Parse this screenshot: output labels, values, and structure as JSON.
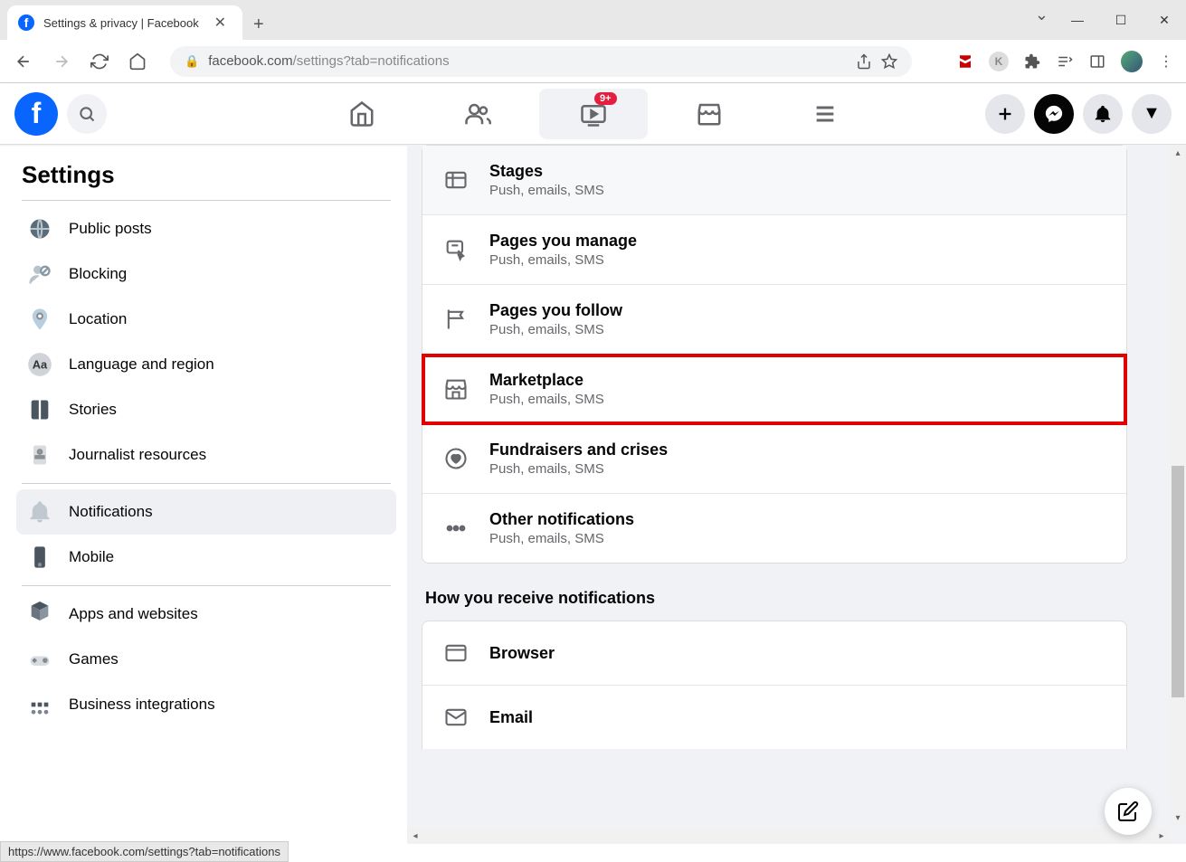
{
  "browser": {
    "tab_title": "Settings & privacy | Facebook",
    "url_host": "facebook.com",
    "url_path": "/settings?tab=notifications"
  },
  "fb_nav": {
    "watch_badge": "9+"
  },
  "sidebar": {
    "title": "Settings",
    "items_top": [
      {
        "label": "Public posts",
        "icon": "globe"
      },
      {
        "label": "Blocking",
        "icon": "user-block"
      },
      {
        "label": "Location",
        "icon": "pin"
      },
      {
        "label": "Language and region",
        "icon": "aa"
      },
      {
        "label": "Stories",
        "icon": "book"
      },
      {
        "label": "Journalist resources",
        "icon": "badge"
      }
    ],
    "items_mid": [
      {
        "label": "Notifications",
        "icon": "bell",
        "active": true
      },
      {
        "label": "Mobile",
        "icon": "mobile"
      }
    ],
    "items_bot": [
      {
        "label": "Apps and websites",
        "icon": "apps"
      },
      {
        "label": "Games",
        "icon": "games"
      },
      {
        "label": "Business integrations",
        "icon": "biz"
      }
    ]
  },
  "main": {
    "rows": [
      {
        "title": "Stages",
        "sub": "Push, emails, SMS",
        "icon": "grid",
        "hovered": true
      },
      {
        "title": "Pages you manage",
        "sub": "Push, emails, SMS",
        "icon": "flag-cursor"
      },
      {
        "title": "Pages you follow",
        "sub": "Push, emails, SMS",
        "icon": "flag"
      },
      {
        "title": "Marketplace",
        "sub": "Push, emails, SMS",
        "icon": "shop",
        "highlighted": true
      },
      {
        "title": "Fundraisers and crises",
        "sub": "Push, emails, SMS",
        "icon": "heart-coin"
      },
      {
        "title": "Other notifications",
        "sub": "Push, emails, SMS",
        "icon": "dots"
      }
    ],
    "section2_title": "How you receive notifications",
    "rows2": [
      {
        "title": "Browser",
        "sub": "",
        "icon": "window"
      },
      {
        "title": "Email",
        "sub": "",
        "icon": "mail"
      }
    ]
  },
  "statusbar": "https://www.facebook.com/settings?tab=notifications"
}
